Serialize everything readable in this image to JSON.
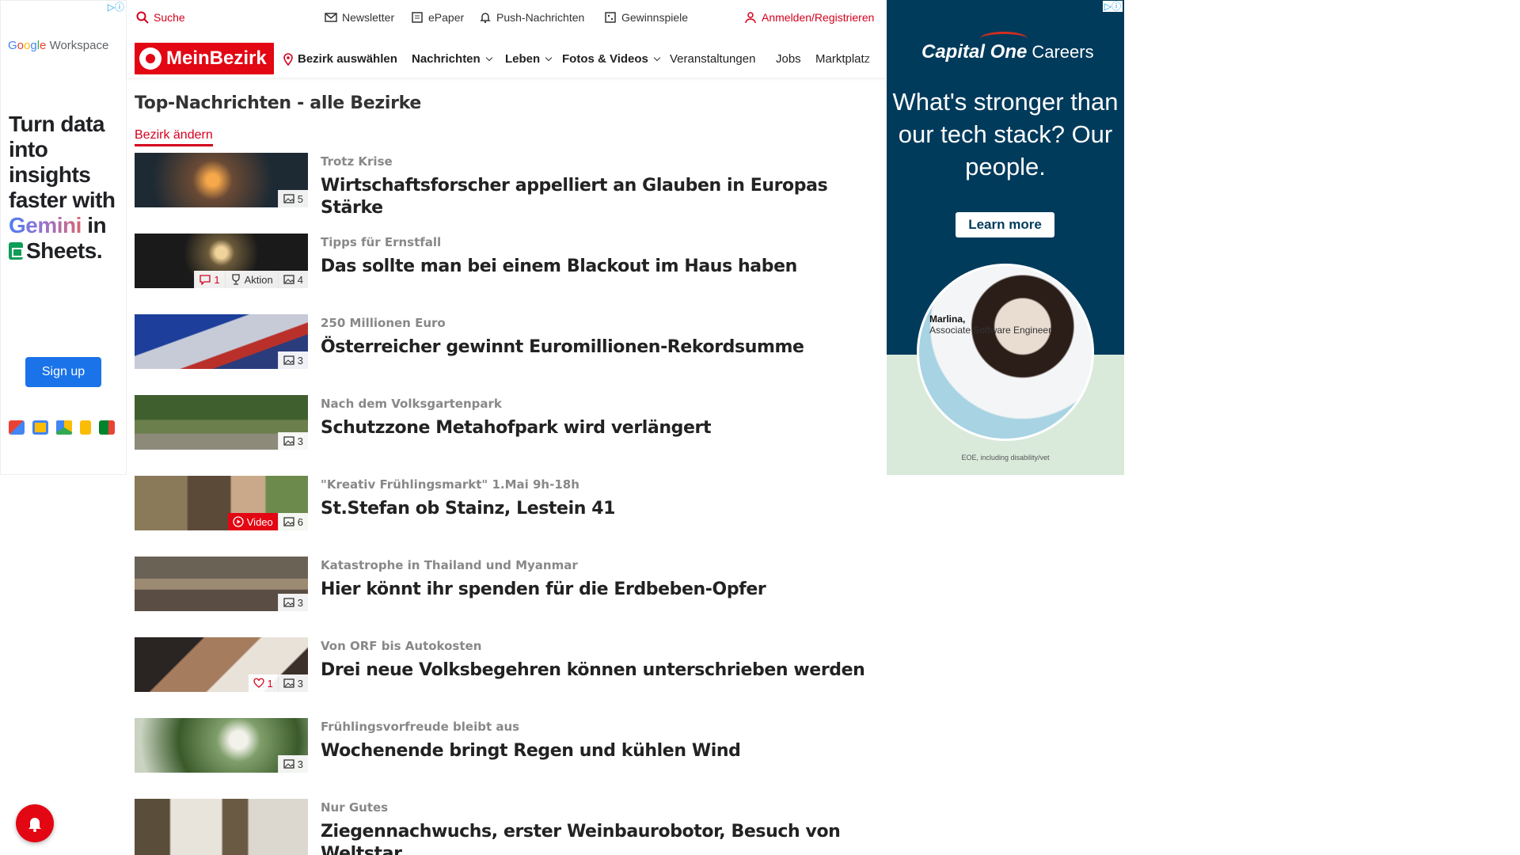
{
  "left_ad": {
    "brand_google": [
      "G",
      "o",
      "o",
      "g",
      "l",
      "e"
    ],
    "brand_workspace": "Workspace",
    "headline_1": "Turn data into insights faster with",
    "headline_gemini": "Gemini",
    "headline_2": "in",
    "headline_3": "Sheets.",
    "cta": "Sign up",
    "icons": [
      "gmail-icon",
      "calendar-icon",
      "drive-icon",
      "keep-icon",
      "meet-icon"
    ],
    "colors": {
      "cta": "#1a73e8"
    }
  },
  "util": {
    "search": "Suche",
    "newsletter": "Newsletter",
    "epaper": "ePaper",
    "push": "Push-Nachrichten",
    "gewinnspiele": "Gewinnspiele",
    "login": "Anmelden/Registrieren"
  },
  "nav": {
    "logo": "MeinBezirk",
    "bezirk": "Bezirk auswählen",
    "items": [
      "Nachrichten",
      "Leben",
      "Fotos & Videos",
      "Veranstaltungen",
      "Jobs",
      "Marktplatz"
    ]
  },
  "main": {
    "title": "Top-Nachrichten - alle Bezirke",
    "change_link": "Bezirk ändern",
    "articles": [
      {
        "kicker": "Trotz Krise",
        "headline": "Wirtschaftsforscher appelliert an Glauben in Europas Stärke",
        "images": "5"
      },
      {
        "kicker": "Tipps für Ernstfall",
        "headline": "Das sollte man bei einem Blackout im Haus haben",
        "comments": "1",
        "aktion": "Aktion",
        "images": "4"
      },
      {
        "kicker": "250 Millionen Euro",
        "headline": "Österreicher gewinnt Euromillionen-Rekordsumme",
        "images": "3"
      },
      {
        "kicker": "Nach dem Volksgartenpark",
        "headline": "Schutzzone Metahofpark wird verlängert",
        "images": "3"
      },
      {
        "kicker": "\"Kreativ Frühlingsmarkt\" 1.Mai 9h-18h",
        "headline": "St.Stefan ob Stainz, Lestein 41",
        "video": "Video",
        "images": "6"
      },
      {
        "kicker": "Katastrophe in Thailand und Myanmar",
        "headline": "Hier könnt ihr spenden für die Erdbeben-Opfer",
        "images": "3"
      },
      {
        "kicker": "Von ORF bis Autokosten",
        "headline": "Drei neue Volksbegehren können unterschrieben werden",
        "likes": "1",
        "images": "3"
      },
      {
        "kicker": "Frühlingsvorfreude bleibt aus",
        "headline": "Wochenende bringt Regen und kühlen Wind",
        "images": "3"
      },
      {
        "kicker": "Nur Gutes",
        "headline": "Ziegennachwuchs, erster Weinbaurobotor, Besuch von Weltstar",
        "images": ""
      }
    ]
  },
  "right_ad": {
    "brand": "Capital One",
    "careers": "Careers",
    "headline": "What's stronger than our tech stack? Our people.",
    "cta": "Learn more",
    "person_name": "Marlina,",
    "person_role": "Associate Software Engineer",
    "eoe": "EOE, including disability/vet",
    "colors": {
      "bg": "#003b5c",
      "lower": "#d9eadb"
    }
  },
  "colors": {
    "brand": "#e30613",
    "link": "#d5001c"
  }
}
